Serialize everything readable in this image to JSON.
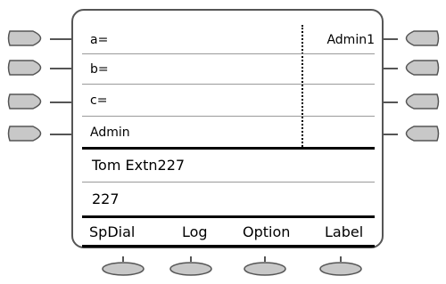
{
  "buttons": {
    "line1": {
      "left": "a=",
      "right": "Admin1"
    },
    "line2": {
      "left": "b=",
      "right": ""
    },
    "line3": {
      "left": "c=",
      "right": ""
    },
    "line4": {
      "left": "Admin",
      "right": ""
    }
  },
  "status": {
    "name": "Tom Extn227",
    "extension": "227"
  },
  "softkeys": [
    "SpDial",
    "Log",
    "Option",
    "Label"
  ],
  "colors": {
    "button_fill": "#c8c8c8",
    "outline": "#555555"
  }
}
